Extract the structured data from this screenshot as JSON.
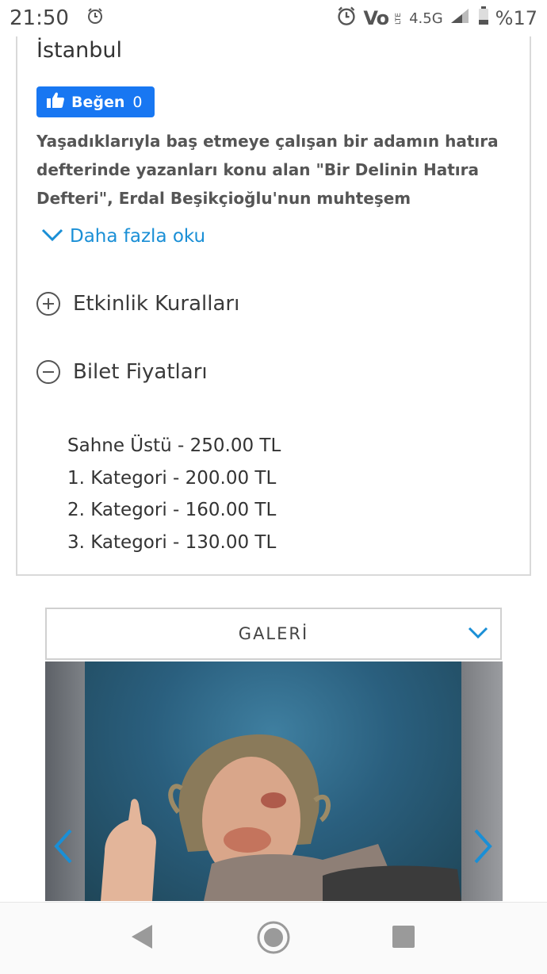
{
  "status_bar": {
    "time": "21:50",
    "network_label": "Vo",
    "lte_label": "LTE",
    "network_type": "4.5G",
    "battery_percent": "%17",
    "icons": [
      "alarm-icon",
      "alarm-icon",
      "volte-icon",
      "signal-icon",
      "battery-icon"
    ]
  },
  "event": {
    "city": "İstanbul",
    "like": {
      "label": "Beğen",
      "count": "0"
    },
    "description_lines": [
      "Yaşadıklarıyla baş etmeye çalışan bir adamın hatıra",
      "defterinde yazanları konu alan \"Bir Delinin Hatıra",
      "Defteri\",  Erdal Beşikçioğlu'nun muhteşem"
    ],
    "read_more": "Daha fazla oku"
  },
  "accordion": [
    {
      "label": "Etkinlik Kuralları",
      "state": "collapsed"
    },
    {
      "label": "Bilet Fiyatları",
      "state": "expanded"
    }
  ],
  "prices": [
    "Sahne Üstü - 250.00 TL",
    "1. Kategori - 200.00 TL",
    "2. Kategori - 160.00 TL",
    "3. Kategori - 130.00 TL"
  ],
  "gallery": {
    "title": "GALERİ"
  },
  "colors": {
    "accent": "#1a8fd6",
    "facebook": "#1877f2"
  }
}
